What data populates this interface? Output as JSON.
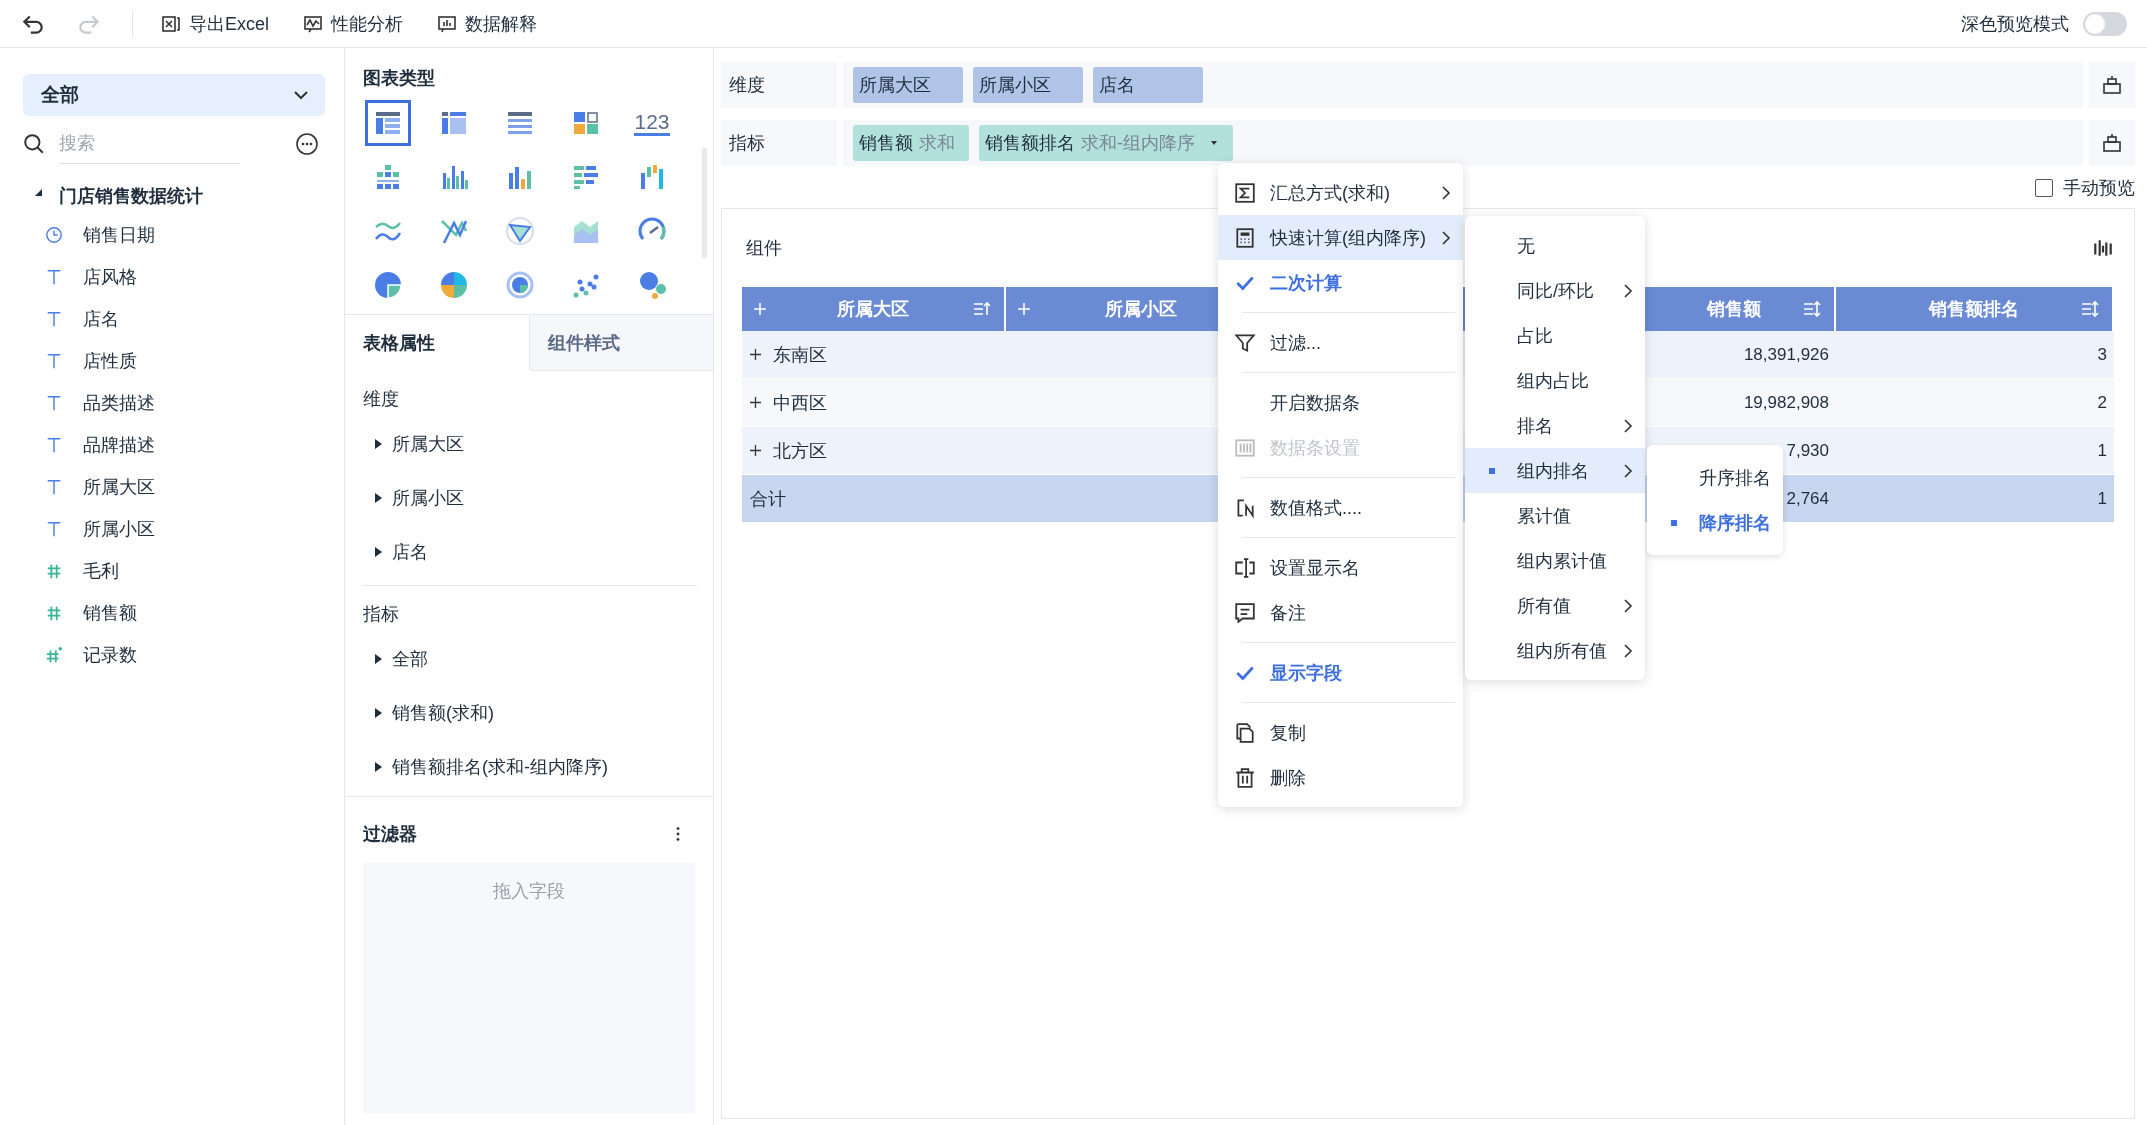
{
  "toolbar": {
    "undo_disabled": false,
    "redo_disabled": true,
    "buttons": [
      "导出Excel",
      "性能分析",
      "数据解释"
    ],
    "dark_mode": {
      "label": "深色预览模式",
      "on": false
    }
  },
  "fields_panel": {
    "scope": "全部",
    "search_placeholder": "搜索",
    "dataset": {
      "name": "门店销售数据统计",
      "expanded": true,
      "children": [
        {
          "name": "销售日期",
          "kind": "date"
        },
        {
          "name": "店风格",
          "kind": "text"
        },
        {
          "name": "店名",
          "kind": "text"
        },
        {
          "name": "店性质",
          "kind": "text"
        },
        {
          "name": "品类描述",
          "kind": "text"
        },
        {
          "name": "品牌描述",
          "kind": "text"
        },
        {
          "name": "所属大区",
          "kind": "text"
        },
        {
          "name": "所属小区",
          "kind": "text"
        },
        {
          "name": "毛利",
          "kind": "number"
        },
        {
          "name": "销售额",
          "kind": "number"
        },
        {
          "name": "记录数",
          "kind": "count"
        }
      ]
    }
  },
  "chart_types": {
    "title": "图表类型",
    "items": [
      {
        "selected": true
      },
      {
        "selected": false
      },
      {
        "selected": false
      },
      {
        "selected": false
      },
      {
        "selected": false,
        "label": "123"
      },
      {
        "selected": false
      },
      {
        "selected": false
      },
      {
        "selected": false
      },
      {
        "selected": false
      },
      {
        "selected": false
      },
      {
        "selected": false
      },
      {
        "selected": false
      },
      {
        "selected": false
      },
      {
        "selected": false
      },
      {
        "selected": false
      },
      {
        "selected": false
      },
      {
        "selected": false
      },
      {
        "selected": false
      },
      {
        "selected": false
      },
      {
        "selected": false
      }
    ]
  },
  "properties": {
    "tabs": [
      {
        "label": "表格属性",
        "selected": true
      },
      {
        "label": "组件样式",
        "selected": false
      }
    ],
    "sections": [
      {
        "title": "维度",
        "items": [
          "所属大区",
          "所属小区",
          "店名"
        ]
      },
      {
        "title": "指标",
        "items": [
          "全部",
          "销售额(求和)",
          "销售额排名(求和-组内降序)"
        ]
      }
    ]
  },
  "filter": {
    "title": "过滤器",
    "placeholder": "拖入字段"
  },
  "shelves": [
    {
      "label": "维度",
      "kind": "dimension",
      "pills": [
        {
          "name": "所属大区"
        },
        {
          "name": "所属小区"
        },
        {
          "name": "店名"
        }
      ]
    },
    {
      "label": "指标",
      "kind": "measure",
      "pills": [
        {
          "name": "销售额",
          "agg": "求和",
          "dropdown": false
        },
        {
          "name": "销售额排名",
          "agg": "求和-组内降序",
          "dropdown": true
        }
      ]
    }
  ],
  "manual_preview": {
    "label": "手动预览",
    "checked": false
  },
  "component": {
    "title": "组件",
    "table": {
      "columns": [
        {
          "label": "所属大区",
          "expandable": true
        },
        {
          "label": "所属小区",
          "expandable": true
        },
        {
          "label": "销售额",
          "expandable": false
        },
        {
          "label": "销售额排名",
          "expandable": false
        }
      ],
      "rows": [
        {
          "region": "东南区",
          "sales": "18,391,926",
          "rank": "3"
        },
        {
          "region": "中西区",
          "sales": "19,982,908",
          "rank": "2"
        },
        {
          "region": "北方区",
          "sales": "7,930",
          "rank": "1"
        }
      ],
      "total": {
        "label": "合计",
        "sales": "2,764",
        "rank": "1"
      }
    }
  },
  "menu": {
    "items": [
      {
        "kind": "item",
        "label": "汇总方式(求和)",
        "submenu": true,
        "selected": false,
        "checked": false,
        "disabled": false
      },
      {
        "kind": "item",
        "label": "快速计算(组内降序)",
        "submenu": true,
        "selected": true,
        "checked": false,
        "disabled": false
      },
      {
        "kind": "item",
        "label": "二次计算",
        "submenu": false,
        "selected": false,
        "checked": true,
        "disabled": false
      },
      {
        "kind": "divider"
      },
      {
        "kind": "item",
        "label": "过滤...",
        "submenu": false,
        "selected": false,
        "checked": false,
        "disabled": false
      },
      {
        "kind": "divider"
      },
      {
        "kind": "item",
        "label": "开启数据条",
        "submenu": false,
        "selected": false,
        "checked": false,
        "disabled": false
      },
      {
        "kind": "item",
        "label": "数据条设置",
        "submenu": false,
        "selected": false,
        "checked": false,
        "disabled": true
      },
      {
        "kind": "divider"
      },
      {
        "kind": "item",
        "label": "数值格式....",
        "submenu": false,
        "selected": false,
        "checked": false,
        "disabled": false
      },
      {
        "kind": "divider"
      },
      {
        "kind": "item",
        "label": "设置显示名",
        "submenu": false,
        "selected": false,
        "checked": false,
        "disabled": false
      },
      {
        "kind": "item",
        "label": "备注",
        "submenu": false,
        "selected": false,
        "checked": false,
        "disabled": false
      },
      {
        "kind": "divider"
      },
      {
        "kind": "item",
        "label": "显示字段",
        "submenu": false,
        "selected": false,
        "checked": true,
        "disabled": false
      },
      {
        "kind": "divider"
      },
      {
        "kind": "item",
        "label": "复制",
        "submenu": false,
        "selected": false,
        "checked": false,
        "disabled": false
      },
      {
        "kind": "item",
        "label": "删除",
        "submenu": false,
        "selected": false,
        "checked": false,
        "disabled": false
      }
    ]
  },
  "submenu": {
    "items": [
      {
        "label": "无",
        "submenu": false,
        "selected": false
      },
      {
        "label": "同比/环比",
        "submenu": true,
        "selected": false
      },
      {
        "label": "占比",
        "submenu": false,
        "selected": false
      },
      {
        "label": "组内占比",
        "submenu": false,
        "selected": false
      },
      {
        "label": "排名",
        "submenu": true,
        "selected": false
      },
      {
        "label": "组内排名",
        "submenu": true,
        "selected": true
      },
      {
        "label": "累计值",
        "submenu": false,
        "selected": false
      },
      {
        "label": "组内累计值",
        "submenu": false,
        "selected": false
      },
      {
        "label": "所有值",
        "submenu": true,
        "selected": false
      },
      {
        "label": "组内所有值",
        "submenu": true,
        "selected": false
      }
    ]
  },
  "subsubmenu": {
    "items": [
      {
        "label": "升序排名",
        "selected": false
      },
      {
        "label": "降序排名",
        "selected": true
      }
    ]
  }
}
